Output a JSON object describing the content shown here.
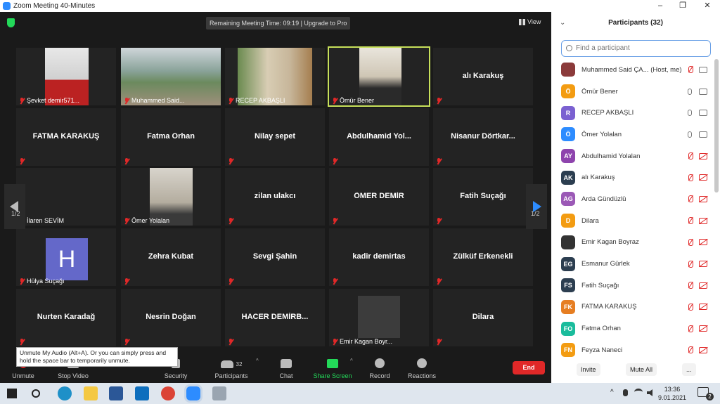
{
  "window": {
    "title": "Zoom Meeting 40-Minutes",
    "controls": [
      "–",
      "❐",
      "✕"
    ]
  },
  "meeting_bar": {
    "timer": "Remaining Meeting Time: 09:19 | Upgrade to Pro",
    "view": "View"
  },
  "tiles": [
    {
      "name": "Şevket demir571...",
      "kind": "video"
    },
    {
      "name": "Muhammed Said...",
      "kind": "video"
    },
    {
      "name": "RECEP AKBAŞLI",
      "kind": "video"
    },
    {
      "name": "Ömür Bener",
      "kind": "video",
      "active": true
    },
    {
      "name": "alı  Karakuş",
      "kind": "text"
    },
    {
      "name": "FATMA KARAKUŞ",
      "kind": "text"
    },
    {
      "name": "Fatma Orhan",
      "kind": "text"
    },
    {
      "name": "Nilay sepet",
      "kind": "text"
    },
    {
      "name": "Abdulhamid  Yol...",
      "kind": "text"
    },
    {
      "name": "Nisanur  Dörtkar...",
      "kind": "text"
    },
    {
      "name": "İlaren SEVİM",
      "kind": "label"
    },
    {
      "name": "Ömer Yolalan",
      "kind": "video"
    },
    {
      "name": "zilan ulakcı",
      "kind": "text"
    },
    {
      "name": "ÖMER DEMİR",
      "kind": "text"
    },
    {
      "name": "Fatih Suçağı",
      "kind": "text"
    },
    {
      "name": "Hülya Suçağı",
      "kind": "avatar",
      "initial": "H"
    },
    {
      "name": "Zehra Kubat",
      "kind": "text"
    },
    {
      "name": "Sevgi Şahin",
      "kind": "text"
    },
    {
      "name": "kadir demirtas",
      "kind": "text"
    },
    {
      "name": "Zülküf Erkenekli",
      "kind": "text"
    },
    {
      "name": "Nurten Karadağ",
      "kind": "text"
    },
    {
      "name": "Nesrin Doğan",
      "kind": "text"
    },
    {
      "name": "HACER   DEMİRB...",
      "kind": "text"
    },
    {
      "name": "Emir Kagan Boyr...",
      "kind": "square"
    },
    {
      "name": "Dilara",
      "kind": "text"
    }
  ],
  "pages": {
    "left": "1/2",
    "right": "1/2"
  },
  "toolbar": {
    "unmute": "Unmute",
    "stop_video": "Stop Video",
    "security": "Security",
    "participants": "Participants",
    "participants_count": "32",
    "chat": "Chat",
    "share_screen": "Share Screen",
    "record": "Record",
    "reactions": "Reactions",
    "end": "End"
  },
  "tooltip": "Unmute My Audio (Alt+A). Or you can simply press and hold the space bar to temporarily unmute.",
  "panel": {
    "title": "Participants (32)",
    "search_placeholder": "Find a participant",
    "invite": "Invite",
    "mute_all": "Mute All",
    "more": "...",
    "participants": [
      {
        "initials": "",
        "name": "Muhammed Said ÇA... (Host, me)",
        "color": "#8b3a3a",
        "mic": "off",
        "cam": "on"
      },
      {
        "initials": "Ö",
        "name": "Ömür Bener",
        "color": "#f39c12",
        "mic": "on",
        "cam": "on"
      },
      {
        "initials": "R",
        "name": "RECEP AKBAŞLI",
        "color": "#7b61d1",
        "mic": "on",
        "cam": "on"
      },
      {
        "initials": "Ö",
        "name": "Ömer Yolalan",
        "color": "#2d8cff",
        "mic": "on",
        "cam": "on"
      },
      {
        "initials": "AY",
        "name": "Abdulhamid Yolalan",
        "color": "#8e44ad",
        "mic": "off",
        "cam": "off"
      },
      {
        "initials": "AK",
        "name": "alı  Karakuş",
        "color": "#2c3e50",
        "mic": "off",
        "cam": "off"
      },
      {
        "initials": "AG",
        "name": "Arda Gündüzlü",
        "color": "#9b59b6",
        "mic": "off",
        "cam": "off"
      },
      {
        "initials": "D",
        "name": "Dilara",
        "color": "#f39c12",
        "mic": "off",
        "cam": "off"
      },
      {
        "initials": "",
        "name": "Emir Kagan Boyraz",
        "color": "#333333",
        "mic": "off",
        "cam": "off"
      },
      {
        "initials": "EG",
        "name": "Esmanur Gürlek",
        "color": "#2c3e50",
        "mic": "off",
        "cam": "off"
      },
      {
        "initials": "FS",
        "name": "Fatih Suçağı",
        "color": "#2c3e50",
        "mic": "off",
        "cam": "off"
      },
      {
        "initials": "FK",
        "name": "FATMA KARAKUŞ",
        "color": "#e67e22",
        "mic": "off",
        "cam": "off"
      },
      {
        "initials": "FO",
        "name": "Fatma Orhan",
        "color": "#1abc9c",
        "mic": "off",
        "cam": "off"
      },
      {
        "initials": "FN",
        "name": "Feyza Naneci",
        "color": "#f39c12",
        "mic": "off",
        "cam": "off"
      }
    ]
  },
  "taskbar": {
    "time": "13:36",
    "date": "9.01.2021",
    "notifications": "2"
  }
}
